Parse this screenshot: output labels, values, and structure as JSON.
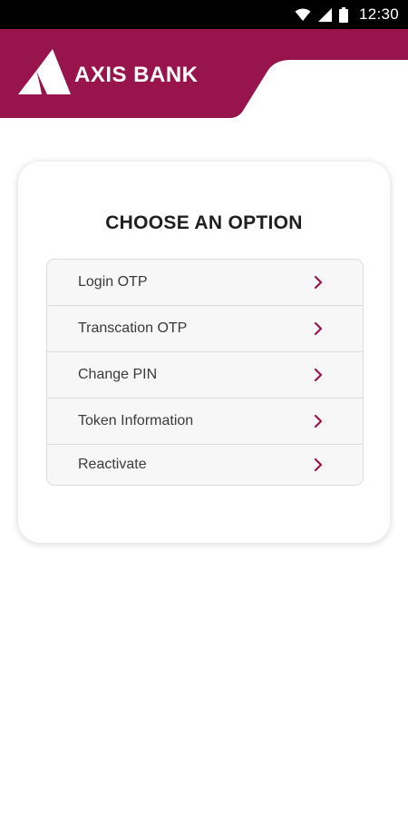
{
  "status_bar": {
    "time": "12:30",
    "icons": [
      "wifi-icon",
      "signal-icon",
      "battery-icon"
    ]
  },
  "header": {
    "brand": "AXIS BANK",
    "brand_color": "#97144d"
  },
  "card": {
    "title": "CHOOSE AN OPTION",
    "options": [
      {
        "label": "Login OTP",
        "icon": "chevron-right-icon"
      },
      {
        "label": "Transcation OTP",
        "icon": "chevron-right-icon"
      },
      {
        "label": "Change PIN",
        "icon": "chevron-right-icon"
      },
      {
        "label": "Token Information",
        "icon": "chevron-right-icon"
      },
      {
        "label": "Reactivate",
        "icon": "chevron-right-icon"
      }
    ]
  }
}
